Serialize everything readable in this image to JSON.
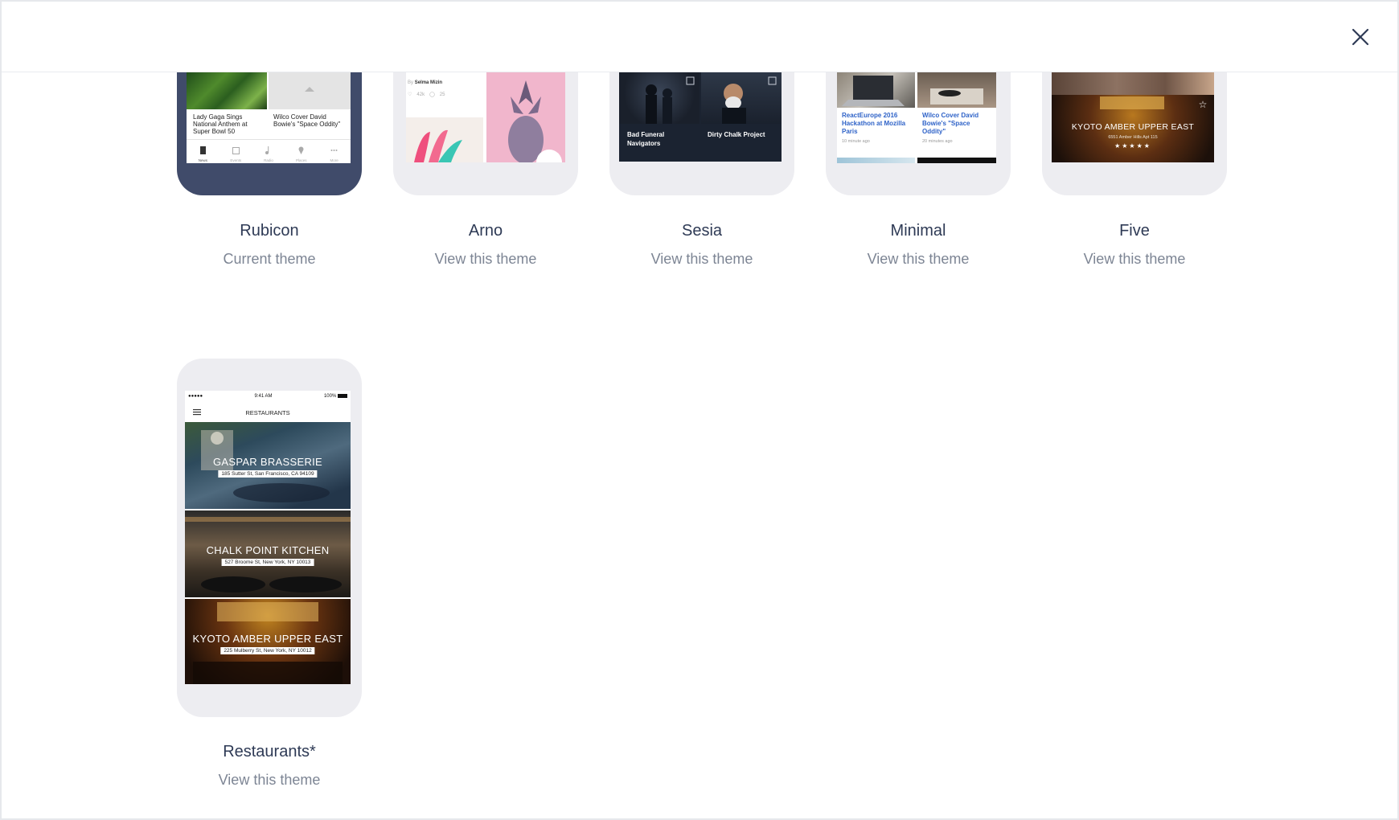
{
  "header": {
    "close_icon": "close-icon"
  },
  "themes": [
    {
      "name": "Rubicon",
      "sub": "Current theme"
    },
    {
      "name": "Arno",
      "sub": "View this theme"
    },
    {
      "name": "Sesia",
      "sub": "View this theme"
    },
    {
      "name": "Minimal",
      "sub": "View this theme"
    },
    {
      "name": "Five",
      "sub": "View this theme"
    },
    {
      "name": "Restaurants*",
      "sub": "View this theme"
    }
  ],
  "previews": {
    "rubicon": {
      "tile1": "Lady Gaga Sings National Anthem at Super Bowl 50",
      "tile2": "Wilco Cover David Bowie's \"Space Oddity\"",
      "tabs": [
        "News",
        "Events",
        "Radio",
        "Places",
        "More"
      ]
    },
    "arno": {
      "author_prefix": "By",
      "author": "Selma Mizin",
      "likes": "42k",
      "comments": "25"
    },
    "sesia": {
      "tile1": "Bad Funeral Navigators",
      "tile2": "Dirty Chalk Project"
    },
    "minimal": {
      "tile1": "ReactEurope 2016 Hackathon at Mozilla Paris",
      "tile1_time": "10 minute ago",
      "tile2": "Wilco Cover David Bowie's \"Space Oddity\"",
      "tile2_time": "20 minutes ago"
    },
    "five": {
      "title": "KYOTO AMBER UPPER EAST",
      "address": "6551 Amber Hills Apt 115",
      "stars": "★★★★★"
    },
    "restaurants": {
      "status_left": "●●●●● ",
      "time": "9:41 AM",
      "battery": "100%",
      "header": "RESTAURANTS",
      "rows": [
        {
          "title": "GASPAR BRASSERIE",
          "address": "185 Sutter St, San Francisco, CA 94109"
        },
        {
          "title": "CHALK POINT KITCHEN",
          "address": "527 Broome St, New York, NY 10013"
        },
        {
          "title": "KYOTO AMBER UPPER EAST",
          "address": "225 Mulberry St, New York, NY 10012"
        }
      ]
    }
  }
}
